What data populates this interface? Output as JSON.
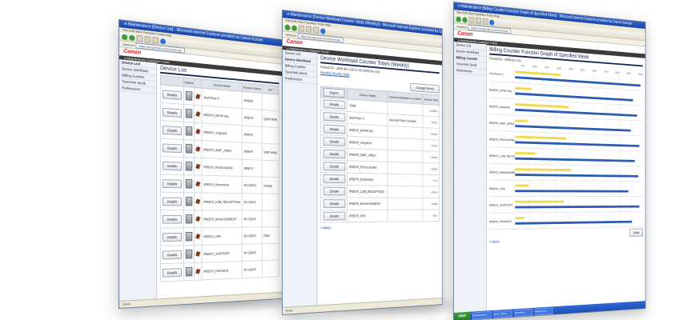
{
  "window1": {
    "title": "e-Maintenance [Device List] - Microsoft Internet Explorer provided by Canon Europe",
    "menu": "File  Edit  View  Favorites  Tools  Help",
    "address_label": "Address",
    "address_url": "https://imaportal.eu/icmm/ei.jsp",
    "logo": "Canon",
    "band": "e-Maintenance  Customer Portal",
    "sidebar": [
      "Device List",
      "Device Workload",
      "Billing Counter",
      "Toner/Ink Stock",
      "Preferences"
    ],
    "heading": "Device List",
    "columns": [
      "",
      "Status",
      "",
      "Device Name",
      "Product Name",
      "Ser"
    ],
    "rows": [
      {
        "button": "Details",
        "name": "2nd Floor C",
        "product": "iR5050"
      },
      {
        "button": "Details",
        "name": "IR5570_DPHP MA",
        "product": "iR5570",
        "extra": "QQH 0045"
      },
      {
        "button": "Details",
        "name": "IR5570_Amjorich",
        "product": "iR5570"
      },
      {
        "button": "Details",
        "name": "IR5570_SMP_AREA",
        "product": "iR5570",
        "extra": "SMP 3049"
      },
      {
        "button": "Details",
        "name": "IR5570_PACKAGING",
        "product": "iR5570"
      },
      {
        "button": "Details",
        "name": "IR5570_Dexmonto",
        "product": "iR C5870",
        "extra": "Ixanga"
      },
      {
        "button": "Details",
        "name": "IR5570_LOB_RECEPTION",
        "product": "iR C5870"
      },
      {
        "button": "Details",
        "name": "IR5570_MANAGEMENT",
        "product": "iR C5870"
      },
      {
        "button": "Details",
        "name": "IR5570_HPA",
        "product": "iR C5870",
        "extra": "EMC"
      },
      {
        "button": "Details",
        "name": "IR5570_SUPPORT",
        "product": "iR C5870"
      },
      {
        "button": "Details",
        "name": "IR5570_FINANCE",
        "product": "iR C5870"
      }
    ],
    "status": "Done"
  },
  "window2": {
    "title": "e-Maintenance [Device Workload Counter Totals (Weekly)] - Microsoft Internet Explorer provided by Canon Europe",
    "menu": "File  Edit  View  Favorites  Tools  Help",
    "address_label": "Address",
    "address_url": "https://imaportal.eu/icmm/ei.jsp",
    "logo": "Canon",
    "band": "e-Maintenance  Customer Portal",
    "sidebar": [
      "Device List",
      "Device Workload",
      "Billing Counter",
      "Toner/Ink Stock",
      "Preferences"
    ],
    "heading": "Device Workload Counter Totals (Weekly)",
    "period": "Period:03 - 2008-BA-120 to 29-2008-BA-121",
    "tabs": "Monthly  Weekly  Daily",
    "change_period": "Change Period",
    "export": "Export",
    "columns": [
      "",
      "Device Name",
      "Device Installation Location",
      "Device Total"
    ],
    "rows": [
      {
        "button": "Details",
        "name": "Total",
        "location": "",
        "count": "1125891"
      },
      {
        "button": "Details",
        "name": "2nd Floor C",
        "location": "Second Floor Corridor",
        "count": "28241"
      },
      {
        "button": "Details",
        "name": "IR5570_DPHP MA",
        "location": "",
        "count": "145200"
      },
      {
        "button": "Details",
        "name": "IR5570_Amjorich",
        "location": "",
        "count": "19342"
      },
      {
        "button": "Details",
        "name": "IR5570_SMP_AREA",
        "location": "",
        "count": "98130"
      },
      {
        "button": "Details",
        "name": "IR5570_PACKAGING",
        "location": "",
        "count": "54092"
      },
      {
        "button": "Details",
        "name": "IR5570_Dexmonto",
        "location": "",
        "count": "7713"
      },
      {
        "button": "Details",
        "name": "IR5570_LOB_RECEPTION",
        "location": "",
        "count": "40418"
      },
      {
        "button": "Details",
        "name": "IR5570_MANAGEMENT",
        "location": "",
        "count": "12566"
      },
      {
        "button": "Details",
        "name": "IR5570_HPA",
        "location": "",
        "count": "3301"
      }
    ],
    "back": "<<Back",
    "status": "Done"
  },
  "window3": {
    "title": "e-Maintenance [Billing Counter Function Graph of Specified Week] - Microsoft Internet Explorer provided by Canon Europe",
    "menu": "File  Edit  View  Favorites  Tools  Help",
    "address_label": "Address",
    "address_url": "https://imaportal.eu/icmm/ei.jsp",
    "logo": "Canon",
    "band": "e-Maintenance  Customer Portal",
    "sidebar": [
      "Device List",
      "Device Workload",
      "Billing Counter",
      "Toner/Ink Stock",
      "Preferences"
    ],
    "heading": "Billing Counter Function Graph of Specified Week",
    "period": "Period:03 - 2008-BA-121",
    "axis_ticks": [
      "0%",
      "10%",
      "20%",
      "30%",
      "40%",
      "50%",
      "60%",
      "70%",
      "80%",
      "90%",
      "100%"
    ],
    "legend_close": "Close",
    "back": "<<Back",
    "rows": [
      {
        "name": "2nd Floor C",
        "yellow": 0.34,
        "blue": 0.98
      },
      {
        "name": "IR5570_DPHP MA",
        "yellow": 0.12,
        "blue": 0.92
      },
      {
        "name": "IR5570_Amjorich",
        "yellow": 0.4,
        "blue": 0.95
      },
      {
        "name": "IR5570_SMP_AREA",
        "yellow": 0.09,
        "blue": 0.9
      },
      {
        "name": "IR5570_PACKAGING",
        "yellow": 0.38,
        "blue": 0.97
      },
      {
        "name": "IR5570_LOB_RECEPTION",
        "yellow": 0.15,
        "blue": 0.93
      },
      {
        "name": "IR5570_MANAGEMENT",
        "yellow": 0.42,
        "blue": 0.96
      },
      {
        "name": "IR5570_HPA",
        "yellow": 0.1,
        "blue": 0.88
      },
      {
        "name": "IR5570_SUPPORT",
        "yellow": 0.36,
        "blue": 0.97
      },
      {
        "name": "IR5570_FINANCE",
        "yellow": 0.07,
        "blue": 0.91
      }
    ],
    "start": "start",
    "taskbar_items": [
      "e-Maintenance",
      "Inbox - Micros...",
      "Document1",
      "Microsoft Po..."
    ],
    "colors": {
      "yellow": "#f2d94c",
      "blue": "#2a5db0"
    }
  }
}
